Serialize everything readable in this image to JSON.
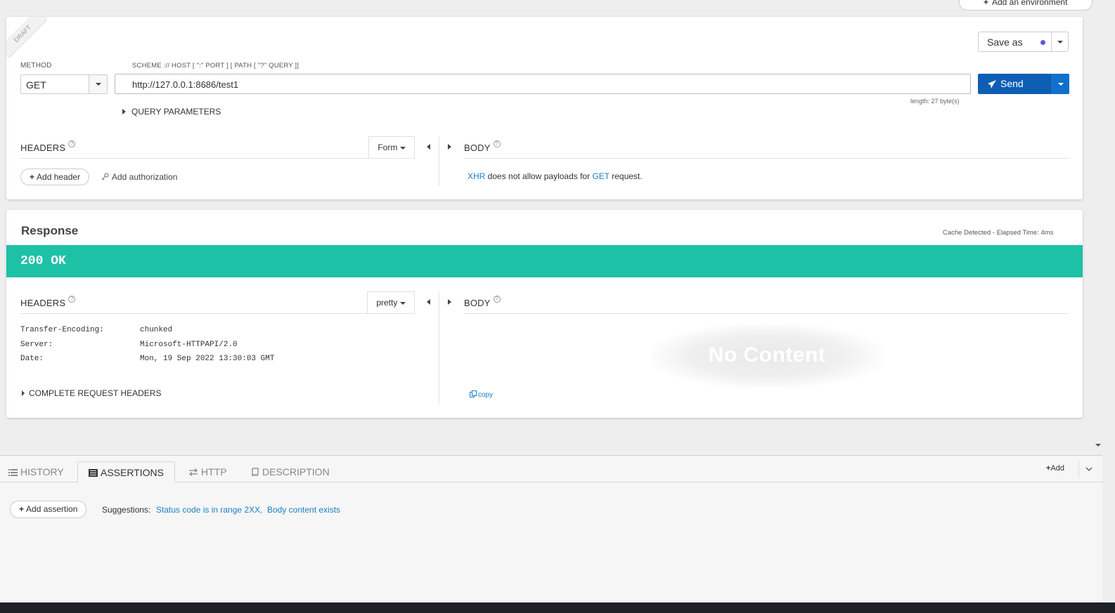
{
  "env": {
    "add_env_label": "Add an environment"
  },
  "request": {
    "draft_label": "DRAFT",
    "save_as_label": "Save as",
    "method_label": "METHOD",
    "method_value": "GET",
    "url_label": "SCHEME :// HOST [ \":\" PORT ] [ PATH [ \"?\" QUERY ]]",
    "url_value": "http://127.0.0.1:8686/test1",
    "send_label": "Send",
    "length_text": "length: 27 byte(s)",
    "query_params_label": "QUERY PARAMETERS",
    "headers_label": "HEADERS",
    "headers_mode": "Form",
    "body_label": "BODY",
    "add_header_label": "Add header",
    "add_auth_label": "Add authorization",
    "body_note": {
      "xhr": "XHR",
      "mid": " does not allow payloads for ",
      "method": "GET",
      "end": " request."
    }
  },
  "response": {
    "title": "Response",
    "meta": "Cache Detected - Elapsed Time: 4ms",
    "status": "200 OK",
    "status_color": "#1dc1a6",
    "headers_label": "HEADERS",
    "headers_mode": "pretty",
    "body_label": "BODY",
    "headers": [
      {
        "name": "Transfer-Encoding:",
        "value": "chunked"
      },
      {
        "name": "Server:",
        "value": "Microsoft-HTTPAPI/2.0"
      },
      {
        "name": "Date:",
        "value": "Mon, 19 Sep 2022 13:30:03 GMT"
      }
    ],
    "complete_headers_label": "COMPLETE REQUEST HEADERS",
    "no_content": "No Content",
    "copy_label": "copy"
  },
  "bottom": {
    "tabs": [
      {
        "label": "HISTORY",
        "icon": "list-icon"
      },
      {
        "label": "ASSERTIONS",
        "icon": "assertions-icon"
      },
      {
        "label": "HTTP",
        "icon": "arrows-icon"
      },
      {
        "label": "DESCRIPTION",
        "icon": "book-icon"
      }
    ],
    "active_tab": "ASSERTIONS",
    "add_label": "Add",
    "add_assertion_label": "Add assertion",
    "suggestions_label": "Suggestions:",
    "suggestions": [
      "Status code is in range 2XX,",
      "Body content exists"
    ]
  }
}
